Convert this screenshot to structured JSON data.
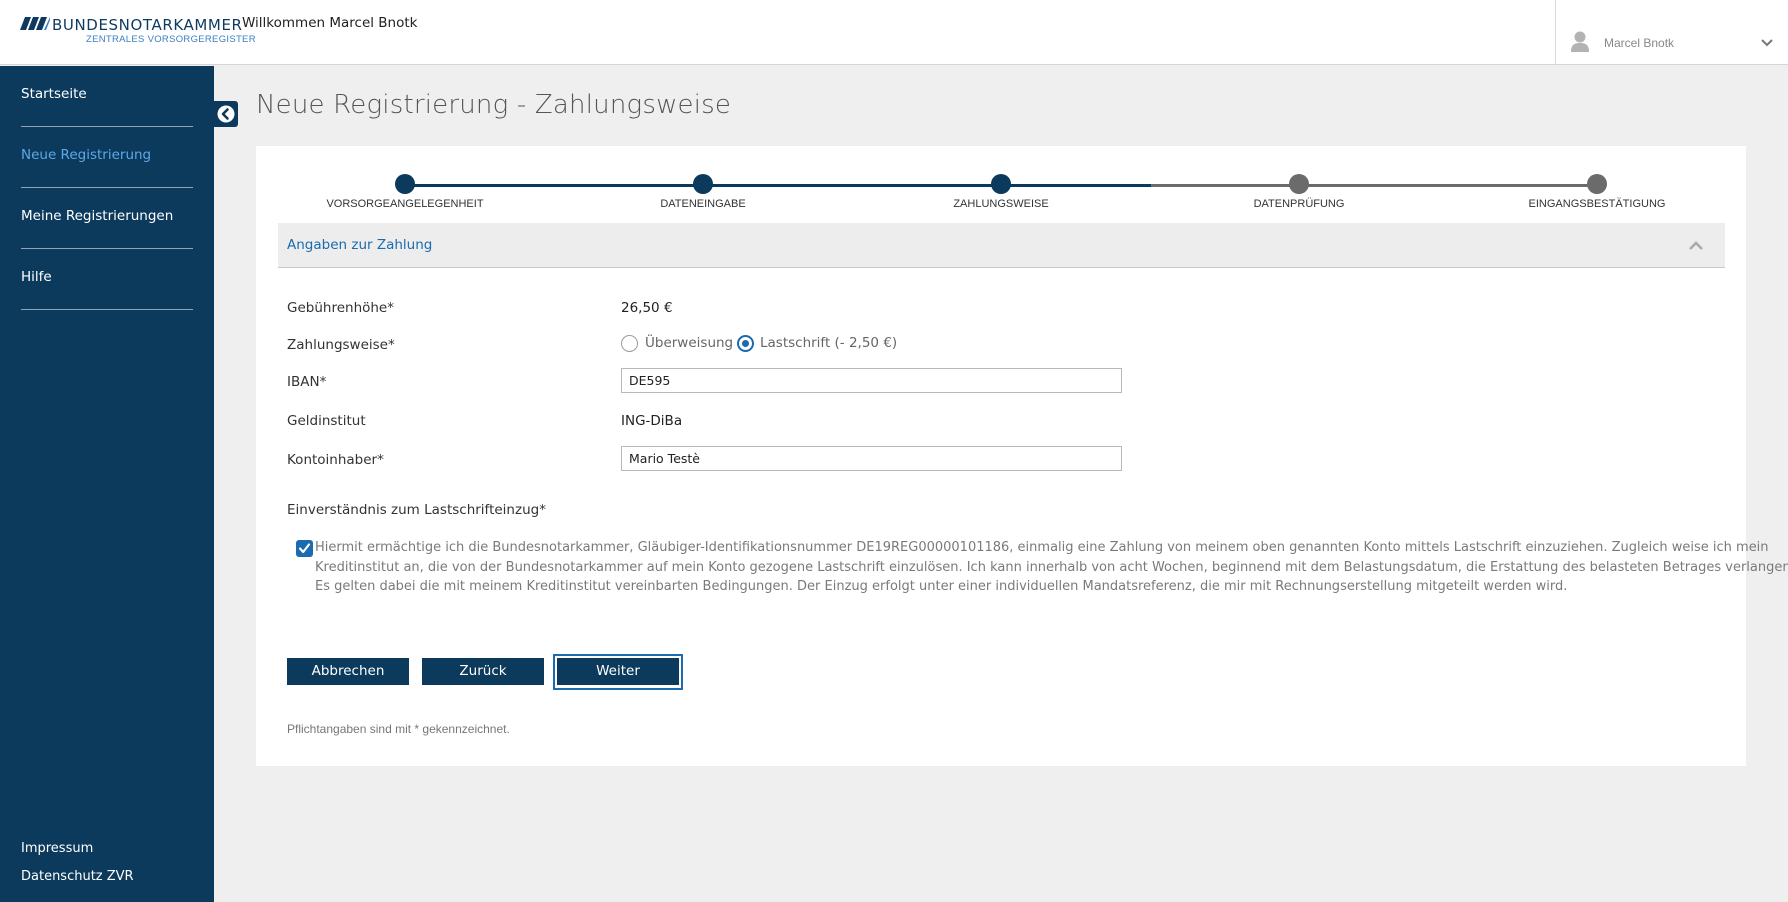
{
  "header": {
    "brand_name": "BUNDESNOTARKAMMER",
    "brand_subtitle": "ZENTRALES VORSORGEREGISTER",
    "welcome": "Willkommen Marcel Bnotk",
    "user_name": "Marcel Bnotk"
  },
  "sidebar": {
    "items": [
      {
        "label": "Startseite"
      },
      {
        "label": "Neue Registrierung"
      },
      {
        "label": "Meine Registrierungen"
      },
      {
        "label": "Hilfe"
      }
    ],
    "footer": {
      "impressum": "Impressum",
      "datenschutz": "Datenschutz ZVR"
    }
  },
  "page": {
    "title": "Neue Registrierung - Zahlungsweise"
  },
  "stepper": {
    "steps": [
      {
        "label": "VORSORGEANGELEGENHEIT",
        "state": "done"
      },
      {
        "label": "DATENEINGABE",
        "state": "done"
      },
      {
        "label": "ZAHLUNGSWEISE",
        "state": "current"
      },
      {
        "label": "DATENPRÜFUNG",
        "state": "pending"
      },
      {
        "label": "EINGANGSBESTÄTIGUNG",
        "state": "pending"
      }
    ]
  },
  "section": {
    "title": "Angaben zur Zahlung"
  },
  "form": {
    "fee_label": "Gebührenhöhe*",
    "fee_value": "26,50 €",
    "payment_label": "Zahlungsweise*",
    "payment_options": [
      {
        "label": "Überweisung",
        "selected": false
      },
      {
        "label": "Lastschrift (- 2,50 €)",
        "selected": true
      }
    ],
    "iban_label": "IBAN*",
    "iban_value": "DE595",
    "bank_label": "Geldinstitut",
    "bank_value": "ING-DiBa",
    "holder_label": "Kontoinhaber*",
    "holder_value": "Mario Testè",
    "consent_label": "Einverständnis zum Lastschrifteinzug*",
    "consent_checked": true,
    "consent_lines": [
      "Hiermit ermächtige ich die Bundesnotarkammer, Gläubiger-Identifikationsnummer DE19REG00000101186, einmalig eine Zahlung von meinem oben genannten Konto mittels Lastschrift einzuziehen. Zugleich weise ich mein",
      "Kreditinstitut an, die von der Bundesnotarkammer auf mein Konto gezogene Lastschrift einzulösen. Ich kann innerhalb von acht Wochen, beginnend mit dem Belastungsdatum, die Erstattung des belasteten Betrages verlangen.",
      "Es gelten dabei die mit meinem Kreditinstitut vereinbarten Bedingungen. Der Einzug erfolgt unter einer individuellen Mandatsreferenz, die mir mit Rechnungserstellung mitgeteilt werden wird."
    ]
  },
  "buttons": {
    "cancel": "Abbrechen",
    "back": "Zurück",
    "next": "Weiter"
  },
  "footnote": "Pflichtangaben sind mit * gekennzeichnet.",
  "colors": {
    "sidebar_bg": "#0c3a5c",
    "accent": "#1a6bb0",
    "active_nav": "#5da8e6",
    "step_done": "#0c3a5c",
    "step_pending": "#6b6b6b"
  }
}
